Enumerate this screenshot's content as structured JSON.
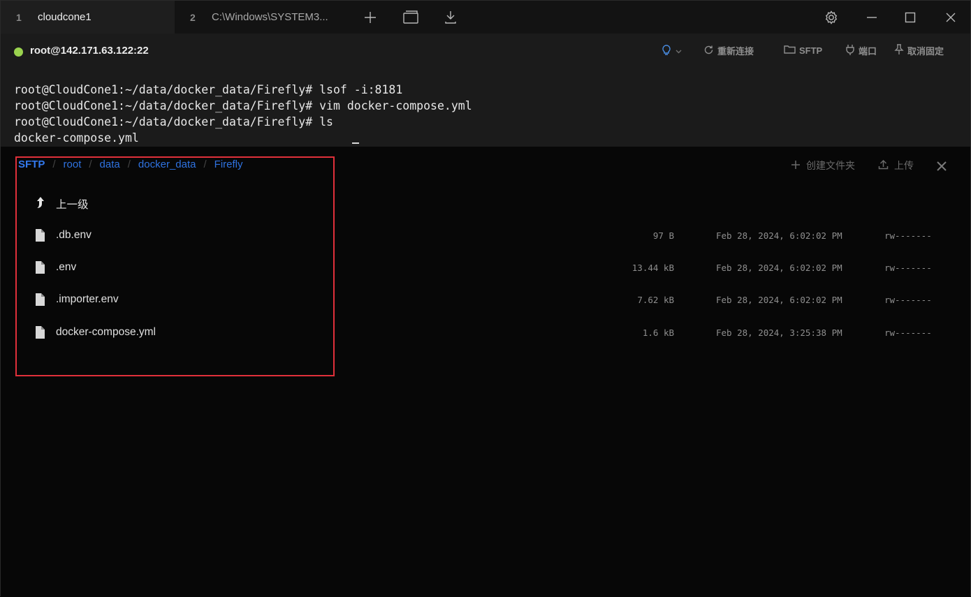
{
  "tabs": [
    {
      "num": "1",
      "title": "cloudcone1"
    },
    {
      "num": "2",
      "title": "C:\\Windows\\SYSTEM3..."
    }
  ],
  "session": {
    "connection": "root@142.171.63.122:22",
    "status_color": "#9ad34f",
    "actions": {
      "reconnect": "重新连接",
      "sftp": "SFTP",
      "port": "端口",
      "unpin": "取消固定"
    }
  },
  "terminal": {
    "lines": [
      "root@CloudCone1:~/data/docker_data/Firefly# lsof -i:8181",
      "root@CloudCone1:~/data/docker_data/Firefly# vim docker-compose.yml",
      "root@CloudCone1:~/data/docker_data/Firefly# ls",
      "docker-compose.yml"
    ]
  },
  "sftp": {
    "breadcrumb": [
      "SFTP",
      "root",
      "data",
      "docker_data",
      "Firefly"
    ],
    "create_folder": "创建文件夹",
    "upload": "上传",
    "parent": "上一级",
    "files": [
      {
        "name": ".db.env",
        "size": "97 B",
        "date": "Feb 28, 2024, 6:02:02 PM",
        "perm": "rw-------"
      },
      {
        "name": ".env",
        "size": "13.44 kB",
        "date": "Feb 28, 2024, 6:02:02 PM",
        "perm": "rw-------"
      },
      {
        "name": ".importer.env",
        "size": "7.62 kB",
        "date": "Feb 28, 2024, 6:02:02 PM",
        "perm": "rw-------"
      },
      {
        "name": "docker-compose.yml",
        "size": "1.6 kB",
        "date": "Feb 28, 2024, 3:25:38 PM",
        "perm": "rw-------"
      }
    ]
  },
  "accent_colors": {
    "link": "#2f72e0",
    "highlight": "#e0303a"
  }
}
